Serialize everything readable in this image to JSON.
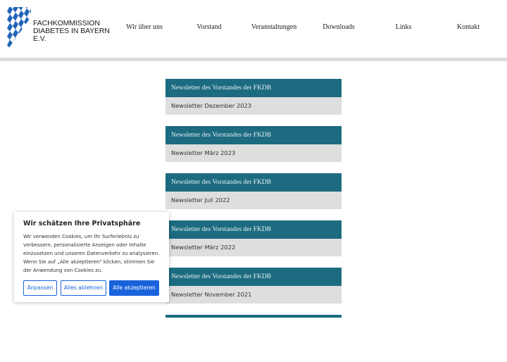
{
  "brand": {
    "line1": "FACHKOMMISSION",
    "line2": "DIABETES IN BAYERN E.V."
  },
  "nav": [
    {
      "label": "Wir über uns"
    },
    {
      "label": "Vorstand"
    },
    {
      "label": "Veranstaltungen"
    },
    {
      "label": "Downloads"
    },
    {
      "label": "Links"
    },
    {
      "label": "Kontakt"
    }
  ],
  "newsletters": [
    {
      "heading": "Newsletter des Vorstandes der FKDB",
      "item": "Newsletter Dezember 2023"
    },
    {
      "heading": "Newsletter des Vorstandes der FKDB",
      "item": "Newsletter März 2023"
    },
    {
      "heading": "Newsletter des Vorstandes der FKDB",
      "item": "Newsletter Juli 2022"
    },
    {
      "heading": "Newsletter des Vorstandes der FKDB",
      "item": "Newsletter März 2022"
    },
    {
      "heading": "Newsletter des Vorstandes der FKDB",
      "item": "Newsletter November 2021"
    }
  ],
  "cookie": {
    "title": "Wir schätzen Ihre Privatsphäre",
    "text": "Wir verwenden Cookies, um Ihr Surferlebnis zu verbessern, personalisierte Anzeigen oder Inhalte einzusetzen und unseren Datenverkehr zu analysieren. Wenn Sie auf „Alle akzeptieren\" klicken, stimmen Sie der Anwendung von Cookies zu.",
    "customize_label": "Anpassen",
    "reject_label": "Alles ablehnen",
    "accept_label": "Alle akzeptieren"
  },
  "colors": {
    "accent": "#1c6b80",
    "cookie_button": "#1863dc",
    "card_body": "#dedede"
  }
}
